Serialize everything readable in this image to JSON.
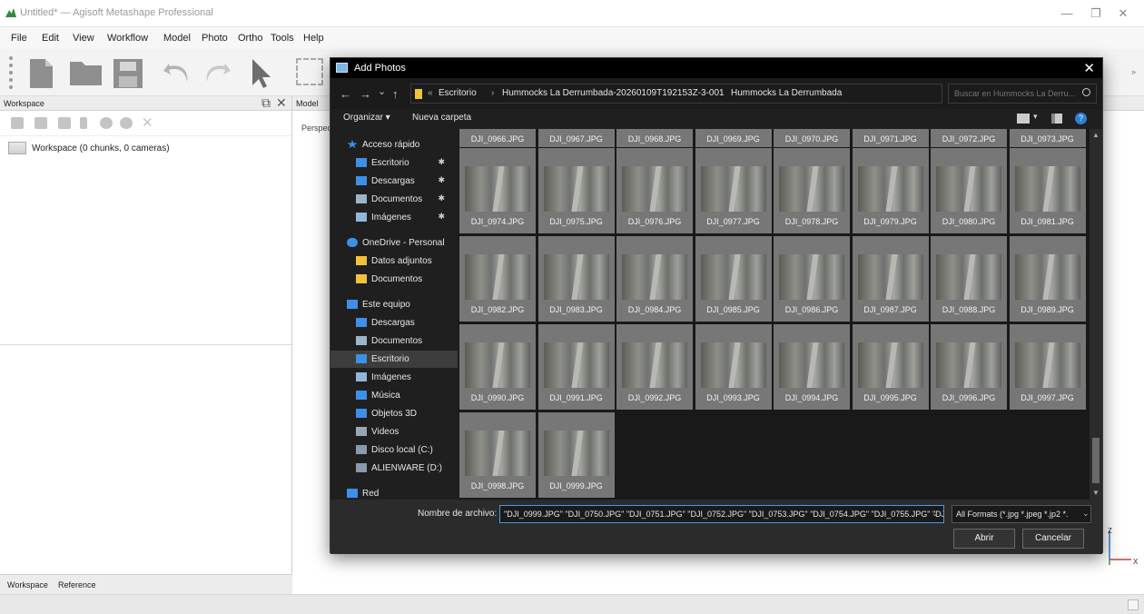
{
  "app": {
    "title": "Untitled* — Agisoft Metashape Professional",
    "win_min": "—",
    "win_max": "❐",
    "win_close": "✕"
  },
  "menu": [
    "File",
    "Edit",
    "View",
    "Workflow",
    "Model",
    "Photo",
    "Ortho",
    "Tools",
    "Help"
  ],
  "workspace": {
    "header": "Workspace",
    "root_label": "Workspace (0 chunks, 0 cameras)",
    "tabs": [
      "Workspace",
      "Reference"
    ]
  },
  "model": {
    "tab": "Model",
    "perspective": "Perspect",
    "axis_z": "Z",
    "axis_x": "X"
  },
  "dialog": {
    "title": "Add Photos",
    "close": "✕",
    "nav": {
      "back": "←",
      "forward": "→",
      "recent": "⌄",
      "up": "↑"
    },
    "breadcrumb": [
      "Escritorio",
      "Hummocks La Derrumbada-20260109T192153Z-3-001",
      "Hummocks La Derrumbada"
    ],
    "crumb_prefix": "«",
    "crumb_sep": "›",
    "search_placeholder": "Buscar en Hummocks La Derru...",
    "commands": {
      "organize": "Organizar ▾",
      "new_folder": "Nueva carpeta"
    },
    "nav_pane": [
      {
        "label": "Acceso rápido",
        "icon": "star-icon",
        "pinned": false,
        "indent": 0
      },
      {
        "label": "Escritorio",
        "icon": "desktop-icon",
        "pinned": true,
        "indent": 1
      },
      {
        "label": "Descargas",
        "icon": "download-icon",
        "pinned": true,
        "indent": 1
      },
      {
        "label": "Documentos",
        "icon": "documents-icon",
        "pinned": true,
        "indent": 1
      },
      {
        "label": "Imágenes",
        "icon": "images-icon",
        "pinned": true,
        "indent": 1
      },
      {
        "label": "OneDrive - Personal",
        "icon": "cloud-icon",
        "pinned": false,
        "indent": 0
      },
      {
        "label": "Datos adjuntos",
        "icon": "folder-icon",
        "pinned": false,
        "indent": 1
      },
      {
        "label": "Documentos",
        "icon": "folder-icon",
        "pinned": false,
        "indent": 1
      },
      {
        "label": "Este equipo",
        "icon": "computer-icon",
        "pinned": false,
        "indent": 0
      },
      {
        "label": "Descargas",
        "icon": "download-icon",
        "pinned": false,
        "indent": 1
      },
      {
        "label": "Documentos",
        "icon": "documents-icon",
        "pinned": false,
        "indent": 1
      },
      {
        "label": "Escritorio",
        "icon": "desktop-icon",
        "pinned": false,
        "indent": 1,
        "selected": true
      },
      {
        "label": "Imágenes",
        "icon": "images-icon",
        "pinned": false,
        "indent": 1
      },
      {
        "label": "Música",
        "icon": "music-icon",
        "pinned": false,
        "indent": 1
      },
      {
        "label": "Objetos 3D",
        "icon": "cube-icon",
        "pinned": false,
        "indent": 1
      },
      {
        "label": "Videos",
        "icon": "video-icon",
        "pinned": false,
        "indent": 1
      },
      {
        "label": "Disco local (C:)",
        "icon": "drive-icon",
        "pinned": false,
        "indent": 1
      },
      {
        "label": "ALIENWARE (D:)",
        "icon": "drive-icon",
        "pinned": false,
        "indent": 1
      },
      {
        "label": "Red",
        "icon": "network-icon",
        "pinned": false,
        "indent": 0
      }
    ],
    "pin_glyph": "✱",
    "files_top_row": [
      "DJI_0966.JPG",
      "DJI_0967.JPG",
      "DJI_0968.JPG",
      "DJI_0969.JPG",
      "DJI_0970.JPG",
      "DJI_0971.JPG",
      "DJI_0972.JPG",
      "DJI_0973.JPG"
    ],
    "files": [
      "DJI_0974.JPG",
      "DJI_0975.JPG",
      "DJI_0976.JPG",
      "DJI_0977.JPG",
      "DJI_0978.JPG",
      "DJI_0979.JPG",
      "DJI_0980.JPG",
      "DJI_0981.JPG",
      "DJI_0982.JPG",
      "DJI_0983.JPG",
      "DJI_0984.JPG",
      "DJI_0985.JPG",
      "DJI_0986.JPG",
      "DJI_0987.JPG",
      "DJI_0988.JPG",
      "DJI_0989.JPG",
      "DJI_0990.JPG",
      "DJI_0991.JPG",
      "DJI_0992.JPG",
      "DJI_0993.JPG",
      "DJI_0994.JPG",
      "DJI_0995.JPG",
      "DJI_0996.JPG",
      "DJI_0997.JPG",
      "DJI_0998.JPG",
      "DJI_0999.JPG"
    ],
    "filename_label": "Nombre de archivo:",
    "filename_value": "\"DJI_0999.JPG\" \"DJI_0750.JPG\" \"DJI_0751.JPG\" \"DJI_0752.JPG\" \"DJI_0753.JPG\" \"DJI_0754.JPG\" \"DJI_0755.JPG\" \"DJI",
    "filter_value": "All Formats (*.jpg *.jpeg *.jp2 *.",
    "open_button": "Abrir",
    "cancel_button": "Cancelar"
  }
}
